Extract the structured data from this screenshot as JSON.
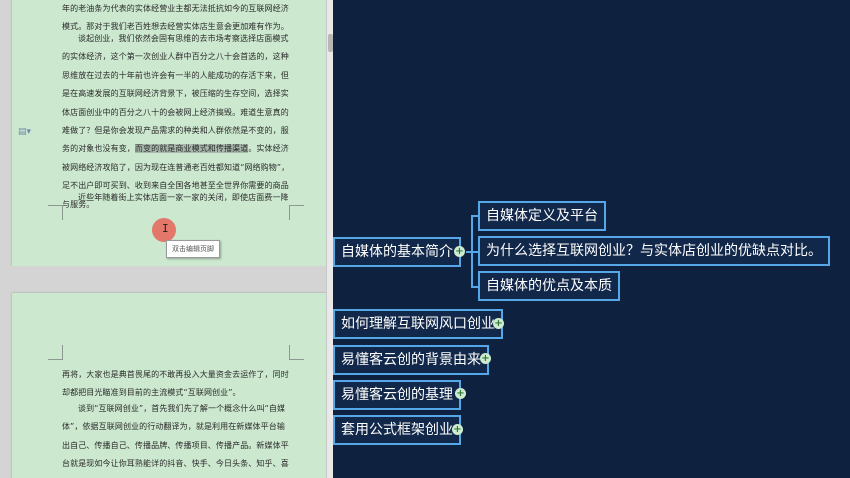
{
  "document": {
    "paragraphs_page1": [
      "年的老油条为代表的实体经营业主都无法抵抗如今的互联网经济模式。那对于我们老百姓想去经营实体店生意会更加难有作为。",
      "谈起创业，我们依然会固有思维的去市场考察选择店面模式的实体经济，这个第一次创业人群中百分之八十会首选的，这种思维放在过去的十年前也许会有一半的人能成功的存活下来，但是在高速发展的互联网经济背景下，被压缩的生存空间，选择实体店面创业中的百分之八十的会被网上经济搞毁。难道生意真的难做了？但是你会发现产品需求的种类和人群依然是不变的，服务的对象也没有变，",
      "而变的就是商业模式和传播渠道",
      "。实体经济被网络经济攻陷了，因为现在连普通老百姓都知道“网络购物”，足不出户即可买到、收到来自全国各地甚至全世界你需要的商品与服务。",
      "近些年随着街上实体店面一家一家的关闭，即使店面费一降"
    ],
    "paragraphs_page2": [
      "再将，大家也是典首畏尾的不敢再投入大量资金去运作了，同时却都把目光瞄准到目前的主流模式“互联网创业”。",
      "谈到“互联网创业”，首先我们先了解一个概念什么叫“自媒体”，依据互联网创业的行动翻译为，就是利用在新媒体平台输出自己、传播自己、传播品牌、传播项目、传播产品。新媒体平台就是现如今让你耳熟能详的抖音、快手、今日头条、知乎、喜马拉雅等大家手机上都会装的这些程序 APP。通过这些新媒体"
    ],
    "tooltip": "双击编辑页脚"
  },
  "mindmap": {
    "root": "自媒体的基本简介",
    "children": [
      "自媒体定义及平台",
      "为什么选择互联网创业？与实体店创业的优缺点对比。",
      "自媒体的优点及本质"
    ],
    "topics": [
      "如何理解互联网风口创业",
      "易懂客云创的背景由来",
      "易懂客云创的基理",
      "套用公式框架创业"
    ],
    "expander_symbol": "+",
    "colors": {
      "background": "#0e2240",
      "node_border": "#55a7e8",
      "doc_page": "#cce8cf"
    }
  }
}
